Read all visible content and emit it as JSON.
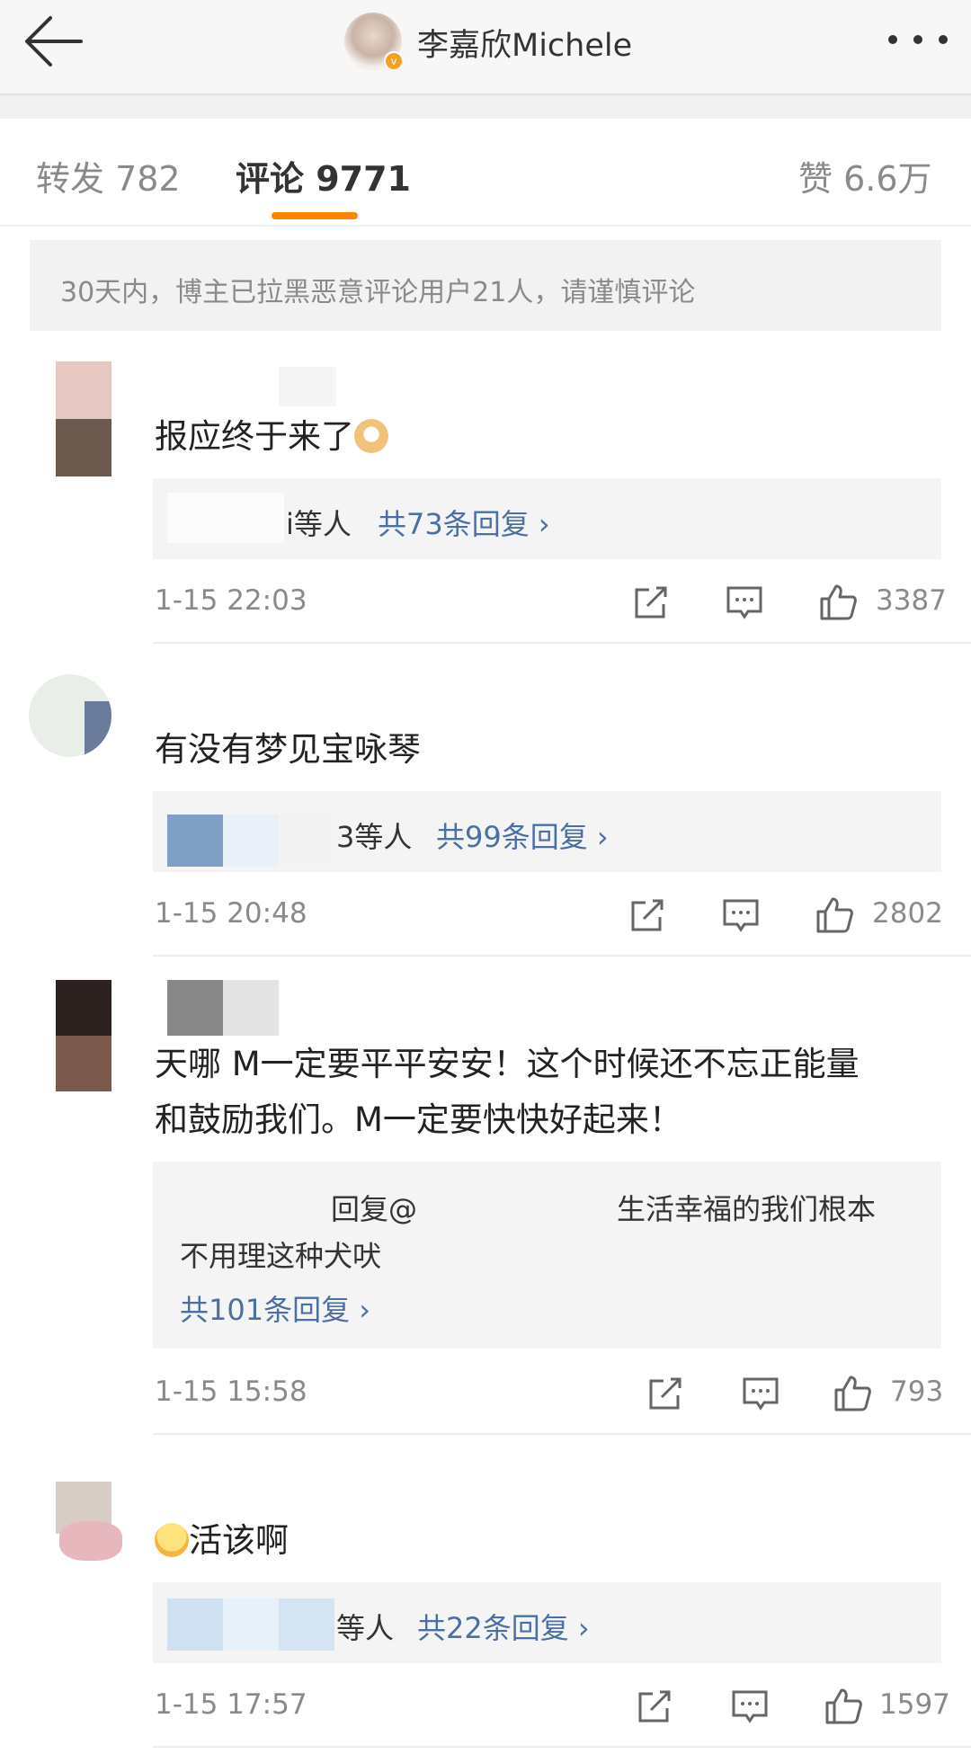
{
  "header": {
    "title": "李嘉欣Michele",
    "back_icon": "arrow-left-icon",
    "more_icon": "more-dots-icon"
  },
  "tabs": [
    {
      "label": "转发 782"
    },
    {
      "label": "评论 9771",
      "active": true
    },
    {
      "label": "赞 6.6万"
    }
  ],
  "notice": "30天内，博主已拉黑恶意评论用户21人，请谨慎评论",
  "comments": [
    {
      "text": "报应终于来了",
      "emoji": "doge-emoji",
      "reply_prefix": "i等人",
      "reply_count": "共73条回复 ›",
      "time": "1-15 22:03",
      "likes": "3387"
    },
    {
      "text": "有没有梦见宝咏琴",
      "reply_prefix": "3等人",
      "reply_count": "共99条回复 ›",
      "time": "1-15 20:48",
      "likes": "2802"
    },
    {
      "text_line1": "天哪 M一定要平平安安！这个时候还不忘正能量",
      "text_line2": "和鼓励我们。M一定要快快好起来！",
      "reply_part1": "回复@",
      "reply_part2": "生活幸福的我们根本",
      "reply_line2": "不用理这种犬吠",
      "reply_count": "共101条回复 ›",
      "time": "1-15 15:58",
      "likes": "793"
    },
    {
      "text": "活该啊",
      "emoji": "smile-emoji",
      "reply_prefix": "等人",
      "reply_count": "共22条回复 ›",
      "time": "1-15 17:57",
      "likes": "1597"
    }
  ],
  "colors": {
    "accent": "#ff8200",
    "link": "#4a6fa5",
    "verify": "#f3a023"
  }
}
